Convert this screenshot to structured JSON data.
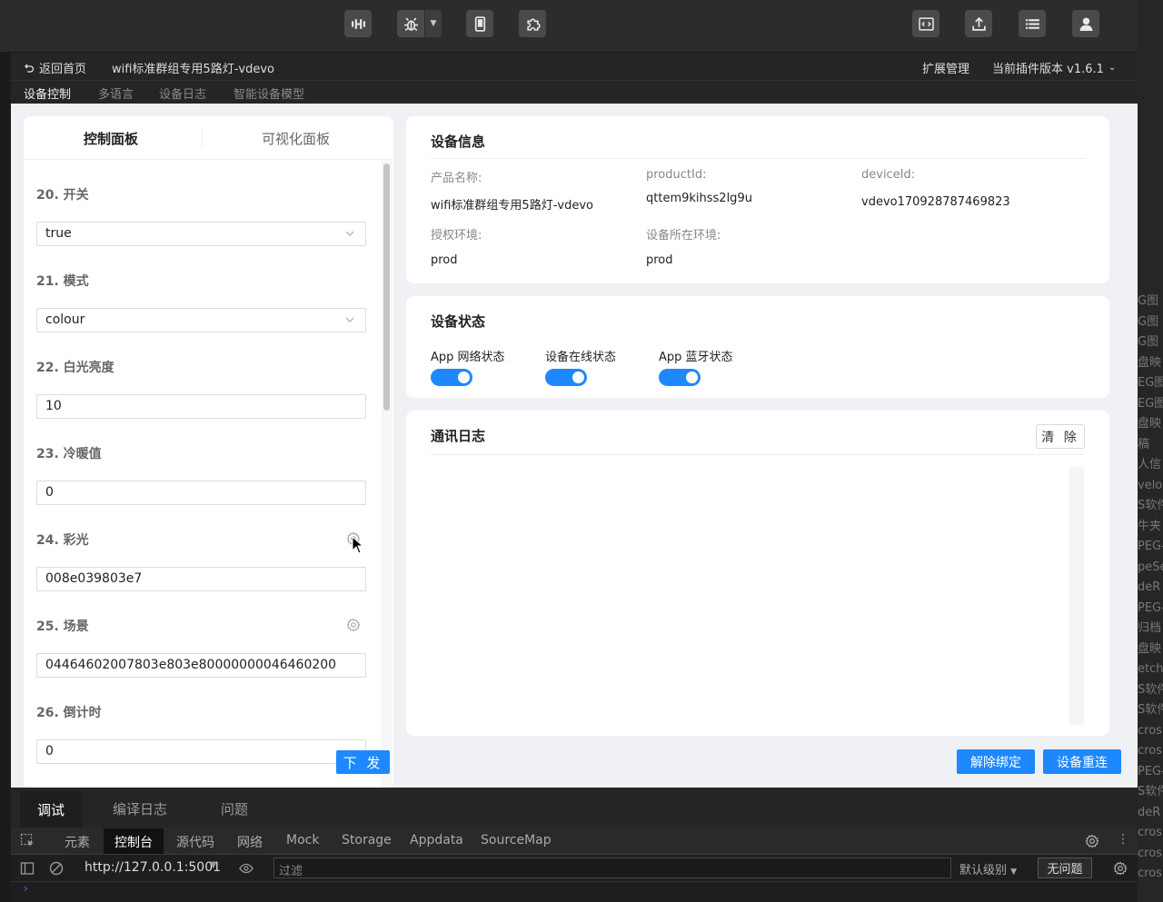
{
  "header": {
    "back_label": "返回首页",
    "project_name": "wifi标准群组专用5路灯-vdevo",
    "ext_manage": "扩展管理",
    "version_label": "当前插件版本 v1.6.1"
  },
  "subnav": {
    "tabs": [
      "设备控制",
      "多语言",
      "设备日志",
      "智能设备模型"
    ],
    "active": "设备控制"
  },
  "left_panel": {
    "tabs": [
      "控制面板",
      "可视化面板"
    ],
    "active_tab": "控制面板",
    "fields": [
      {
        "label": "20. 开关",
        "value": "true",
        "type": "select"
      },
      {
        "label": "21. 模式",
        "value": "colour",
        "type": "select"
      },
      {
        "label": "22. 白光亮度",
        "value": "10",
        "type": "input"
      },
      {
        "label": "23. 冷暖值",
        "value": "0",
        "type": "input"
      },
      {
        "label": "24. 彩光",
        "value": "008e039803e7",
        "type": "input",
        "gear": true
      },
      {
        "label": "25. 场景",
        "value": "04464602007803e803e80000000046460200",
        "type": "input",
        "gear": true
      },
      {
        "label": "26. 倒计时",
        "value": "0",
        "type": "input"
      }
    ],
    "send_label": "下 发"
  },
  "device_info": {
    "title": "设备信息",
    "product_name_label": "产品名称:",
    "product_name": "wifi标准群组专用5路灯-vdevo",
    "product_id_label": "productId:",
    "product_id": "qttem9kihss2lg9u",
    "device_id_label": "deviceId:",
    "device_id": "vdevo170928787469823",
    "auth_env_label": "授权环境:",
    "auth_env": "prod",
    "device_env_label": "设备所在环境:",
    "device_env": "prod"
  },
  "device_status": {
    "title": "设备状态",
    "toggles": [
      {
        "label": "App 网络状态",
        "on": true
      },
      {
        "label": "设备在线状态",
        "on": true
      },
      {
        "label": "App 蓝牙状态",
        "on": true
      }
    ]
  },
  "comm_log": {
    "title": "通讯日志",
    "clear_label": "清 除"
  },
  "actions": {
    "unbind_label": "解除绑定",
    "reconnect_label": "设备重连"
  },
  "devtools": {
    "tabs": [
      "调试",
      "编译日志",
      "问题"
    ],
    "active_tab": "调试",
    "nav": [
      "元素",
      "控制台",
      "源代码",
      "网络",
      "Mock",
      "Storage",
      "Appdata",
      "SourceMap"
    ],
    "active_nav": "控制台",
    "url": "http://127.0.0.1:5001",
    "filter_placeholder": "过滤",
    "level_label": "默认级别",
    "no_issues_label": "无问题"
  },
  "background_window": {
    "items": [
      "G图",
      "G图",
      "G图",
      "盘映",
      "EG图",
      "EG图",
      "盘映",
      "稿",
      "人信",
      "velo",
      "S软件",
      "牛夹",
      "PEG-",
      "peSe",
      "deR",
      "PEG-",
      "归档",
      "盘映",
      "etch",
      "S软件",
      "S软件",
      "cros",
      "cros",
      "PEG-",
      "S软件",
      "deR",
      "cros",
      "cros",
      "cros"
    ]
  },
  "colors": {
    "accent": "#1e88ff",
    "toolbar_bg": "#2c2c2c",
    "main_bg": "#eff1f5"
  }
}
